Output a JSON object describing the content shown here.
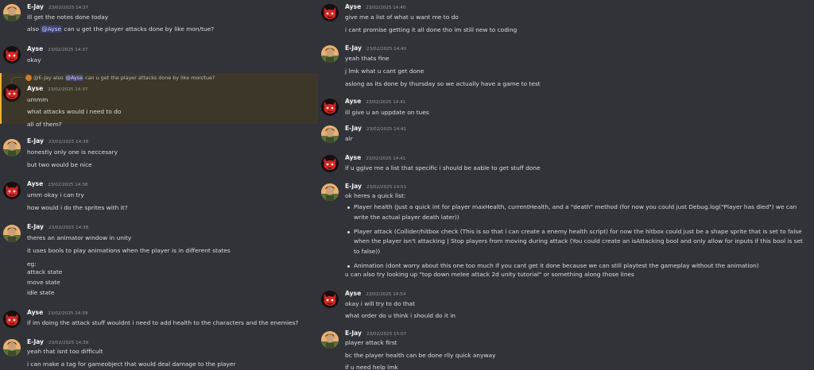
{
  "users": {
    "ejay": "E-Jay",
    "ayse": "Ayse"
  },
  "left_messages": [
    {
      "author": "E-Jay",
      "time": "23/02/2025 14:37",
      "lines": [
        "ill get the notes done today"
      ]
    },
    {
      "author": "Ayse",
      "time": "23/02/2025 14:37",
      "lines": [
        "okay"
      ]
    },
    {
      "author": "Ayse",
      "time": "23/02/2025 14:37",
      "lines": [
        "ummm",
        "what attacks would i  need to do",
        "all of them?"
      ]
    },
    {
      "author": "E-Jay",
      "time": "23/02/2025 14:38",
      "lines": [
        "honestly only one is neccesary",
        "but two would be nice"
      ]
    },
    {
      "author": "Ayse",
      "time": "23/02/2025 14:38",
      "lines": [
        "umm okay i can try",
        "how would i do the sprites with it?"
      ]
    },
    {
      "author": "E-Jay",
      "time": "23/02/2025 14:38",
      "lines": [
        "theres an animator window in unity",
        "it uses bools to play animations when the player is in different states",
        "eg:",
        "attack state",
        "move state",
        "idle state"
      ]
    },
    {
      "author": "Ayse",
      "time": "23/02/2025 14:39",
      "lines": [
        "if im doing the attack stuff wouldnt i need to add health to the characters and the enemies?"
      ]
    },
    {
      "author": "E-Jay",
      "time": "23/02/2025 14:39",
      "lines": [
        "yeah that isnt too difficult",
        "i can make a tag for gameobject that would deal damage to the player"
      ]
    }
  ],
  "mention_line": {
    "pre": "also ",
    "mention": "@Ayse",
    "post": " can u get the player attacks done by like mon/tue?"
  },
  "reply": {
    "author": "@E-Jay",
    "pre": " also ",
    "mention": "@Ayse",
    "post": " can u get the player attacks done by like mon/tue?"
  },
  "right_messages": [
    {
      "author": "Ayse",
      "time": "23/02/2025 14:40",
      "lines": [
        "give me a list of what u want me to do",
        "i cant promise getting it all done tho im still new to coding"
      ]
    },
    {
      "author": "E-Jay",
      "time": "23/02/2025 14:40",
      "lines": [
        "yeah thats fine",
        "j lmk what u cant get done",
        "aslong as its done by thursday so we actually have a game to test"
      ]
    },
    {
      "author": "Ayse",
      "time": "23/02/2025 14:41",
      "lines": [
        "ill give u an uppdate on tues"
      ]
    },
    {
      "author": "E-Jay",
      "time": "23/02/2025 14:41",
      "lines": [
        "alr"
      ]
    },
    {
      "author": "Ayse",
      "time": "23/02/2025 14:41",
      "lines": [
        "if u ggive me a list that specific i should be aable to get stuff done"
      ]
    },
    {
      "author": "E-Jay",
      "time": "23/02/2025 14:51",
      "lines": [
        "ok heres a quick list:"
      ]
    },
    {
      "author": "Ayse",
      "time": "23/02/2025 14:54",
      "lines": [
        "okay i will try to do that",
        "what order do u think i should do it in"
      ]
    },
    {
      "author": "E-Jay",
      "time": "23/02/2025 15:07",
      "lines": [
        "player attack first",
        "bc the player health can be done rlly quick anyway",
        "if u need help lmk"
      ]
    }
  ],
  "quick_list": [
    "Player health (Just a quick int for player maxHealth, currentHealth, and a \"death\" method (for now you could just Debug.log(\"Player has died\") we can write the actual player death later))",
    "Player attack (Collider/hitbox check (This is so that i can create a enemy health script) for now the hitbox could just be a shape sprite that is set to false when the player isn't attacking | Stop players from moving during attack (You could create an isAttacking bool and only allow for inputs if this bool is set to false))",
    "Animation (dont worry about this one too much if you cant get it done because we can still playtest the gameplay without the animation)"
  ],
  "after_list": "u can also try looking up \"top down melee attack 2d unity tutorial\" or something along those lines",
  "colors": {
    "bg": "#313338",
    "highlight": "#3c3728",
    "highlight_bar": "#f0b232",
    "mention_bg": "#5865f2"
  },
  "icons": {
    "ayse_avatar": "red-cat-avatar-icon",
    "ejay_avatar": "portrait-avatar-icon"
  }
}
